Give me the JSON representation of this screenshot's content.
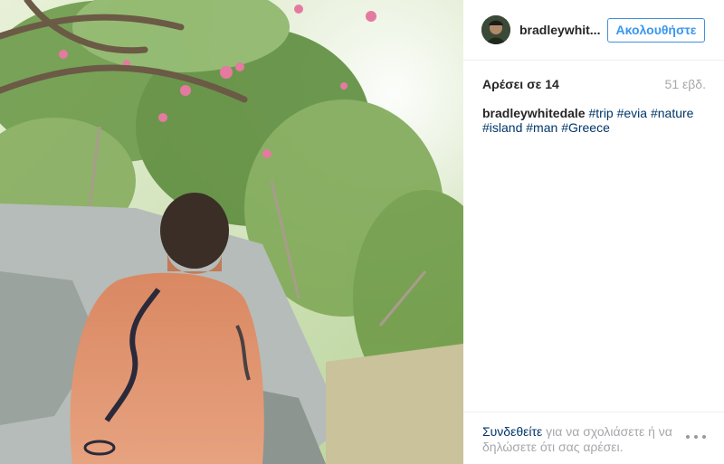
{
  "header": {
    "username": "bradleywhit...",
    "follow_label": "Ακολουθήστε"
  },
  "stats": {
    "likes": "Αρέσει σε 14",
    "time": "51 εβδ."
  },
  "caption": {
    "author": "bradleywhitedale",
    "hashtags": [
      "#trip",
      "#evia",
      "#nature",
      "#island",
      "#man",
      "#Greece"
    ]
  },
  "footer": {
    "login_link": "Συνδεθείτε",
    "login_rest": " για να σχολιάσετε ή να δηλώσετε ότι σας αρέσει."
  },
  "colors": {
    "accent": "#3897f0",
    "link": "#003569",
    "muted": "#a5a7aa"
  },
  "icons": {
    "more": "more-options-icon"
  }
}
